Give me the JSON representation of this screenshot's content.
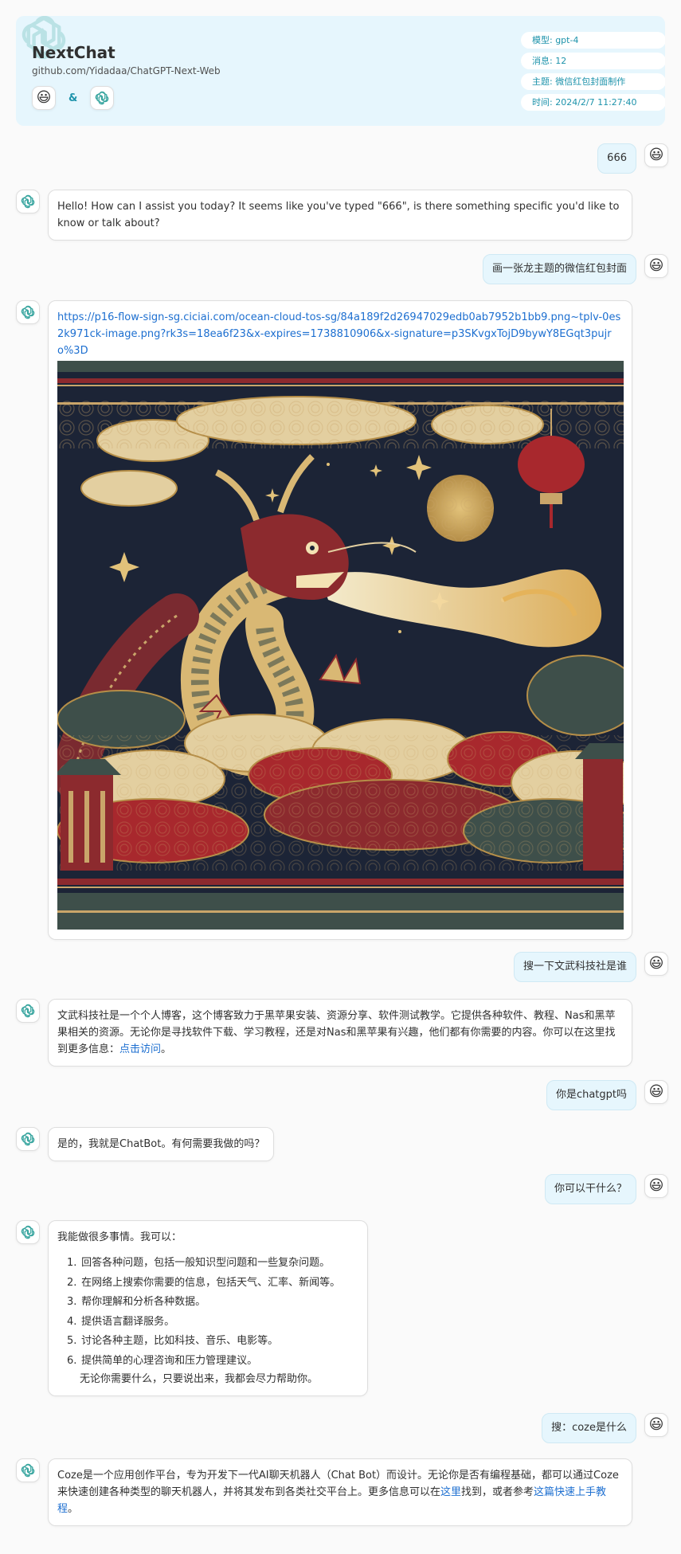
{
  "header": {
    "title": "NextChat",
    "subtitle": "github.com/Yidadaa/ChatGPT-Next-Web",
    "amp": "&",
    "meta": {
      "model": "模型: gpt-4",
      "messages": "消息: 12",
      "topic": "主题: 微信红包封面制作",
      "time": "时间: 2024/2/7 11:27:40"
    }
  },
  "messages": {
    "u1": "666",
    "b1": "Hello! How can I assist you today? It seems like you've typed \"666\", is there something specific you'd like to know or talk about?",
    "u2": "画一张龙主题的微信红包封面",
    "b2_link": "https://p16-flow-sign-sg.ciciai.com/ocean-cloud-tos-sg/84a189f2d26947029edb0ab7952b1bb9.png~tplv-0es2k971ck-image.png?rk3s=18ea6f23&x-expires=1738810906&x-signature=p3SKvgxTojD9bywY8EGqt3pujro%3D",
    "u3": "搜一下文武科技社是谁",
    "b3_text": "文武科技社是一个个人博客，这个博客致力于黑苹果安装、资源分享、软件测试教学。它提供各种软件、教程、Nas和黑苹果相关的资源。无论你是寻找软件下载、学习教程，还是对Nas和黑苹果有兴趣，他们都有你需要的内容。你可以在这里找到更多信息：",
    "b3_link": "点击访问",
    "b3_end": "。",
    "u4": "你是chatgpt吗",
    "b4": "是的，我就是ChatBot。有何需要我做的吗？",
    "u5": "你可以干什么？",
    "b5_intro": "我能做很多事情。我可以：",
    "b5_items": [
      "回答各种问题，包括一般知识型问题和一些复杂问题。",
      "在网络上搜索你需要的信息，包括天气、汇率、新闻等。",
      "帮你理解和分析各种数据。",
      "提供语言翻译服务。",
      "讨论各种主题，比如科技、音乐、电影等。",
      "提供简单的心理咨询和压力管理建议。"
    ],
    "b5_tail": "无论你需要什么，只要说出来，我都会尽力帮助你。",
    "u6": "搜：coze是什么",
    "b6_text": "Coze是一个应用创作平台，专为开发下一代AI聊天机器人（Chat Bot）而设计。无论你是否有编程基础，都可以通过Coze来快速创建各种类型的聊天机器人，并将其发布到各类社交平台上。更多信息可以在",
    "b6_link1": "这里",
    "b6_mid": "找到，或者参考",
    "b6_link2": "这篇快速上手教程",
    "b6_end": "。"
  },
  "icons": {
    "user_avatar": "smiley-emoji-icon",
    "bot_avatar": "openai-logo-icon"
  },
  "colors": {
    "accent": "#1d93ab",
    "header_bg": "#e6f6fd",
    "link": "#1d6fd0"
  }
}
